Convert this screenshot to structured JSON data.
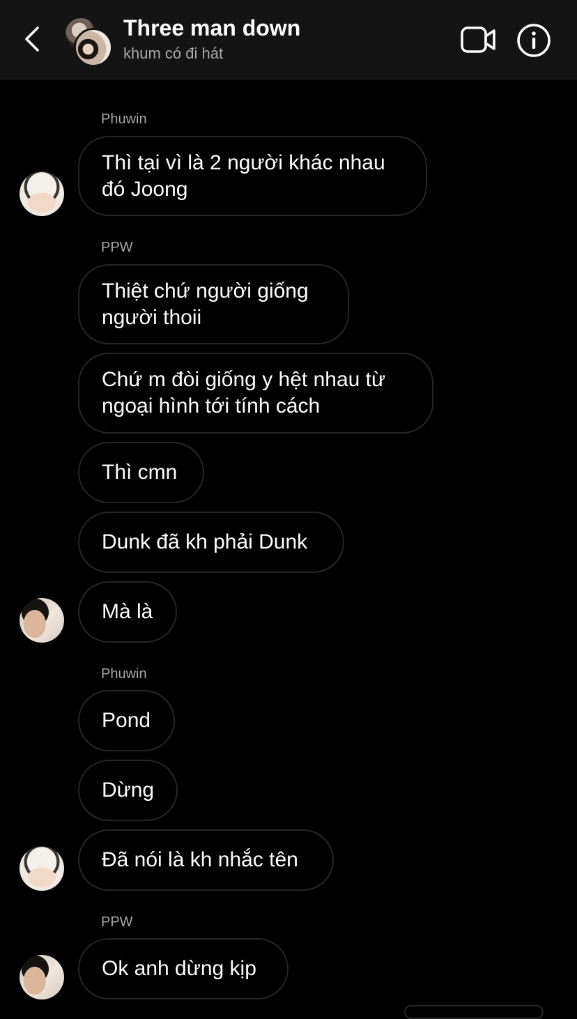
{
  "header": {
    "title": "Three man down",
    "subtitle": "khum có đi hát",
    "back_icon": "chevron-left-icon",
    "video_icon": "video-camera-icon",
    "info_icon": "info-icon"
  },
  "messages": [
    {
      "sender": "Phuwin"
    },
    {
      "text": "Thì tại vì là 2 người khác nhau\nđó Joong"
    },
    {
      "sender": "PPW"
    },
    {
      "text": "Thiệt chứ người giống\nngười thoii"
    },
    {
      "text": "Chứ m đòi giống y hệt nhau từ\nngoại hình tới tính cách"
    },
    {
      "text": "Thì cmn"
    },
    {
      "text": "Dunk đã kh phải Dunk"
    },
    {
      "text": "Mà là"
    },
    {
      "sender": "Phuwin"
    },
    {
      "text": "Pond"
    },
    {
      "text": "Dừng"
    },
    {
      "text": "Đã nói là kh nhắc tên"
    },
    {
      "sender": "PPW"
    },
    {
      "text": "Ok anh dừng kịp"
    }
  ],
  "colors": {
    "background": "#000000",
    "header_bg": "#141414",
    "bubble_border": "#262626",
    "secondary_text": "#a8a8a8"
  }
}
